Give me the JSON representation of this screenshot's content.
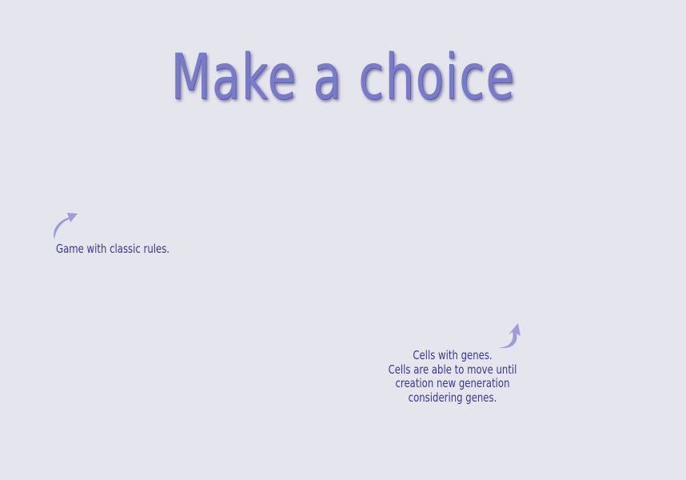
{
  "page": {
    "title": "Make a choice"
  },
  "options": {
    "classic": {
      "caption": "Game with classic rules.",
      "icon": "curved-arrow-icon"
    },
    "genes": {
      "lines": [
        "Cells with genes.",
        "Cells are able to move until",
        "creation new generation",
        "considering genes."
      ],
      "icon": "curved-arrow-icon"
    }
  },
  "colors": {
    "background": "#e5e5ee",
    "title": "#7a7acb",
    "caption": "#39398f",
    "arrow": "#9c9cd8"
  }
}
